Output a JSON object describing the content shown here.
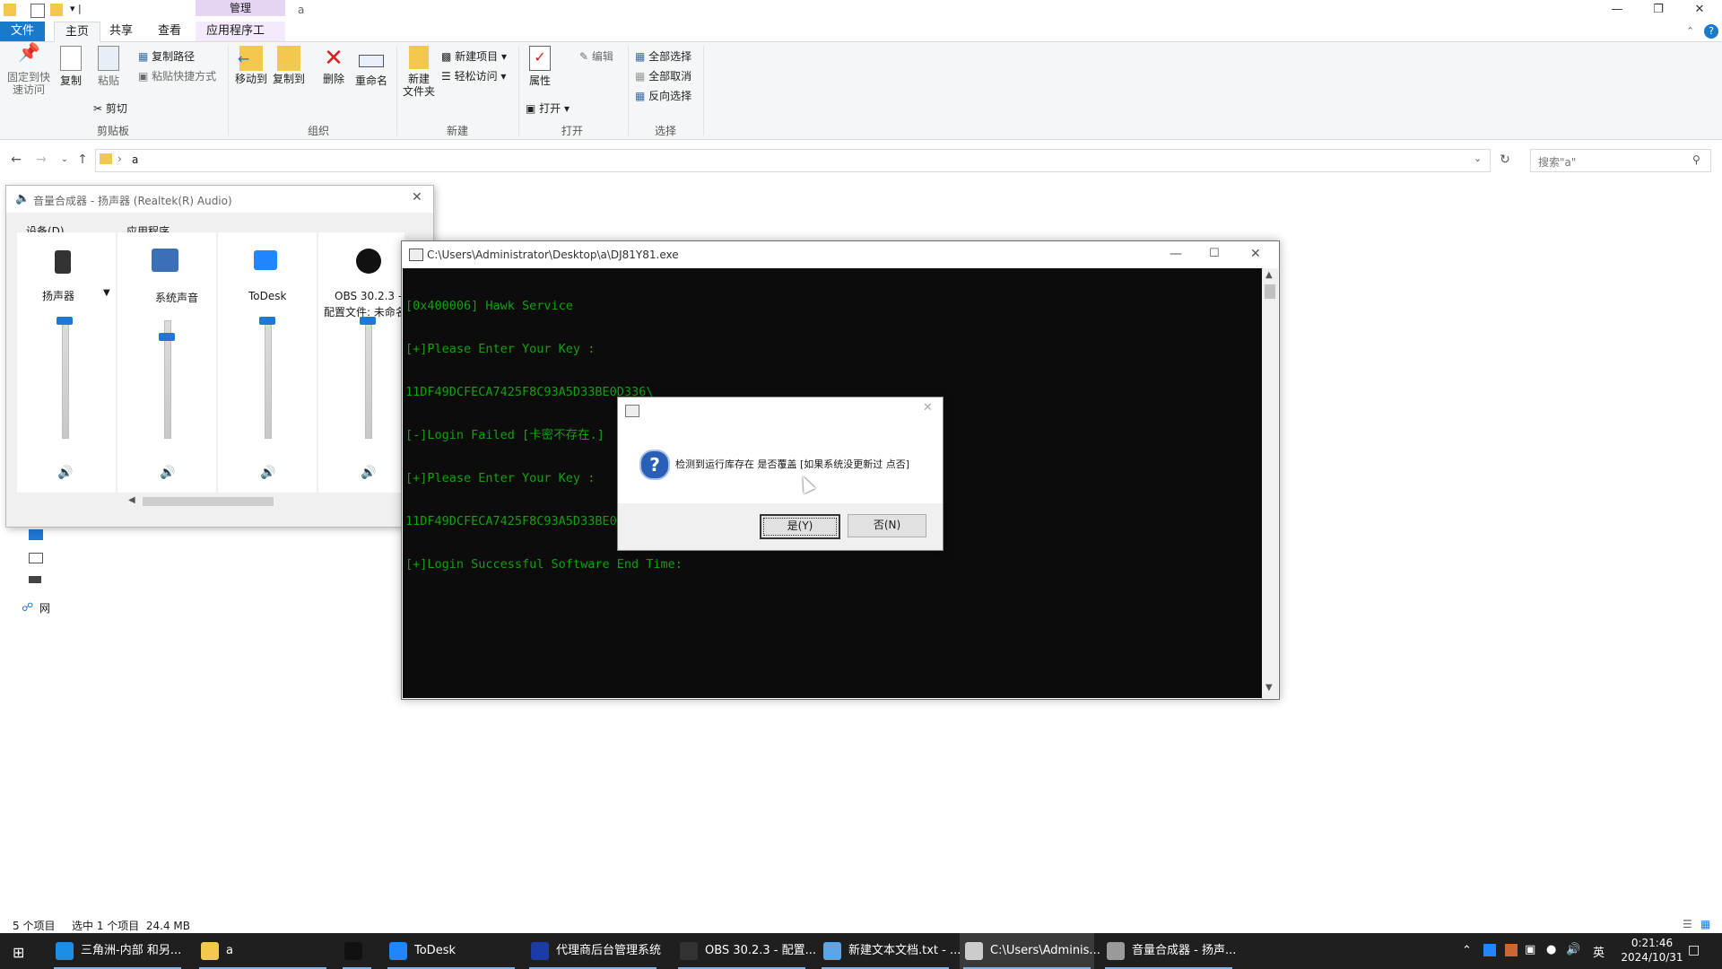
{
  "explorer": {
    "title": "a",
    "manage_tab": "管理",
    "tabs": [
      "文件",
      "主页",
      "共享",
      "查看",
      "应用程序工具"
    ],
    "clipboard": {
      "pin": "固定到快速访问",
      "copy": "复制",
      "paste": "粘贴",
      "copy_path": "复制路径",
      "paste_shortcut": "粘贴快捷方式",
      "cut": "剪切",
      "group": "剪贴板"
    },
    "organize": {
      "move_to": "移动到",
      "copy_to": "复制到",
      "delete": "删除",
      "rename": "重命名",
      "group": "组织"
    },
    "new": {
      "new_folder": "新建\n文件夹",
      "new_item": "新建项目",
      "easy_access": "轻松访问",
      "group": "新建"
    },
    "open": {
      "properties": "属性",
      "open": "打开",
      "edit": "编辑",
      "group": "打开"
    },
    "select": {
      "select_all": "全部选择",
      "select_none": "全部取消",
      "invert": "反向选择",
      "group": "选择"
    },
    "address": {
      "folder": "a"
    },
    "search_placeholder": "搜索\"a\"",
    "nav_fragments": [
      "网"
    ],
    "status": {
      "items": "5 个项目",
      "selected": "选中 1 个项目  24.4 MB"
    }
  },
  "mixer": {
    "title": "音量合成器 - 扬声器 (Realtek(R) Audio)",
    "device_label": "设备(D)",
    "apps_label": "应用程序",
    "device": {
      "name": "扬声器",
      "level": 1.0
    },
    "apps": [
      {
        "name": "系统声音",
        "level": 0.85
      },
      {
        "name": "ToDesk",
        "level": 1.0
      },
      {
        "name": "OBS 30.2.3 -",
        "subname": "配置文件: 未命名",
        "level": 1.0
      }
    ]
  },
  "console": {
    "title": "C:\\Users\\Administrator\\Desktop\\a\\DJ81Y81.exe",
    "lines": [
      "[0x400006] Hawk Service",
      "[+]Please Enter Your Key :",
      "11DF49DCFECA7425F8C93A5D33BE0D336\\",
      "[-]Login Failed [卡密不存在.]",
      "[+]Please Enter Your Key :",
      "11DF49DCFECA7425F8C93A5D33BE0D336",
      "[+]Login Successful Software End Time:"
    ]
  },
  "dialog": {
    "message": "检测到运行库存在 是否覆盖 [如果系统没更新过 点否]",
    "yes": "是(Y)",
    "no": "否(N)"
  },
  "taskbar": {
    "items": [
      {
        "label": "三角洲-内部 和另...",
        "icon_color": "#1d8ee6"
      },
      {
        "label": "a",
        "icon_color": "#f2c94c"
      },
      {
        "label": "",
        "icon_color": "#111111"
      },
      {
        "label": "ToDesk",
        "icon_color": "#1f86ff"
      },
      {
        "label": "代理商后台管理系统",
        "icon_color": "#1b3ca6"
      },
      {
        "label": "OBS 30.2.3 - 配置...",
        "icon_color": "#333333"
      },
      {
        "label": "新建文本文档.txt - ...",
        "icon_color": "#5da5e6"
      },
      {
        "label": "C:\\Users\\Adminis...",
        "icon_color": "#cccccc"
      },
      {
        "label": "音量合成器 - 扬声...",
        "icon_color": "#9a9a9a"
      }
    ],
    "ime": "英",
    "time": "0:21:46",
    "date": "2024/10/31"
  }
}
